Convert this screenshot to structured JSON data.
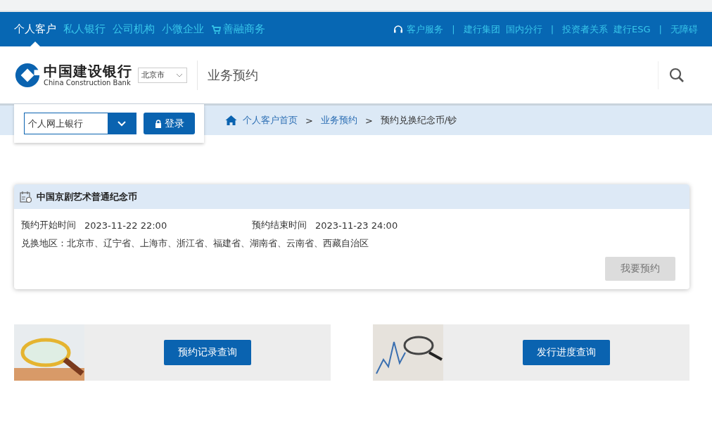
{
  "top_nav": {
    "items": [
      {
        "label": "个人客户",
        "selected": true,
        "kind": "plain"
      },
      {
        "label": "私人银行",
        "selected": false,
        "kind": "plain"
      },
      {
        "label": "公司机构",
        "selected": false,
        "kind": "plain"
      },
      {
        "label": "小微企业",
        "selected": false,
        "kind": "plain"
      },
      {
        "label": "善融商务",
        "selected": false,
        "kind": "cart"
      }
    ],
    "links": [
      {
        "label": "客户服务",
        "kind": "headset"
      },
      {
        "kind": "sep",
        "label": "|"
      },
      {
        "label": "建行集团",
        "kind": "plain"
      },
      {
        "label": "国内分行",
        "kind": "plain"
      },
      {
        "kind": "sep",
        "label": "|"
      },
      {
        "label": "投资者关系",
        "kind": "plain"
      },
      {
        "label": "建行ESG",
        "kind": "plain"
      },
      {
        "kind": "sep",
        "label": "|"
      },
      {
        "label": "无障碍",
        "kind": "plain"
      }
    ]
  },
  "header": {
    "logo_cn": "中国建设银行",
    "logo_en": "China Construction Bank",
    "city": "北京市",
    "page_title": "业务预约"
  },
  "login": {
    "channel": "个人网上银行",
    "button": "登录"
  },
  "breadcrumb": [
    {
      "label": "个人客户首页",
      "kind": "link"
    },
    {
      "label": ">",
      "kind": "sep"
    },
    {
      "label": "业务预约",
      "kind": "link"
    },
    {
      "label": ">",
      "kind": "sep"
    },
    {
      "label": "预约兑换纪念币/钞",
      "kind": "current"
    }
  ],
  "card": {
    "title": "中国京剧艺术普通纪念币",
    "start_label": "预约开始时间",
    "start": "2023-11-22 22:00",
    "end_label": "预约结束时间",
    "end": "2023-11-23 24:00",
    "region": "兑换地区：北京市、辽宁省、上海市、浙江省、福建省、湖南省、云南省、西藏自治区",
    "button": "我要预约",
    "button_disabled": true
  },
  "panels": [
    {
      "button": "预约记录查询",
      "kind": "magnifier"
    },
    {
      "button": "发行进度查询",
      "kind": "chart"
    }
  ]
}
